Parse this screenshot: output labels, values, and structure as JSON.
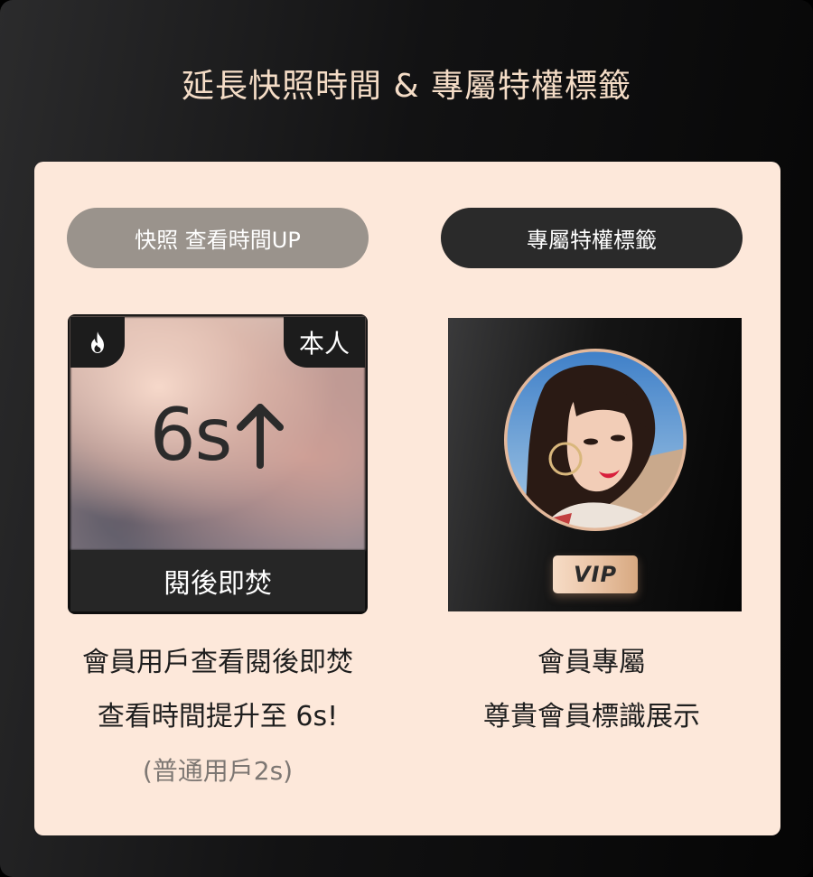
{
  "header": {
    "title": "延長快照時間 & 專屬特權標籤"
  },
  "left": {
    "pill_label": "快照 查看時間UP",
    "snapshot": {
      "badge_self": "本人",
      "time_value": "6s",
      "footer_label": "閱後即焚"
    },
    "desc": {
      "line1": "會員用戶查看閱後即焚",
      "line2": "查看時間提升至 6s!",
      "line3": "(普通用戶2s)"
    }
  },
  "right": {
    "pill_label": "專屬特權標籤",
    "vip_badge": "VIP",
    "desc": {
      "line1": "會員專屬",
      "line2": "尊貴會員標識展示"
    }
  },
  "colors": {
    "title": "#f4dcc6",
    "panel_bg": "#fde8da",
    "pill_inactive": "#9a938c",
    "pill_active": "#2a2a2a",
    "vip_gold": "#e8c2a3"
  },
  "icons": {
    "flame": "flame-icon",
    "arrow": "arrow-up-icon"
  }
}
